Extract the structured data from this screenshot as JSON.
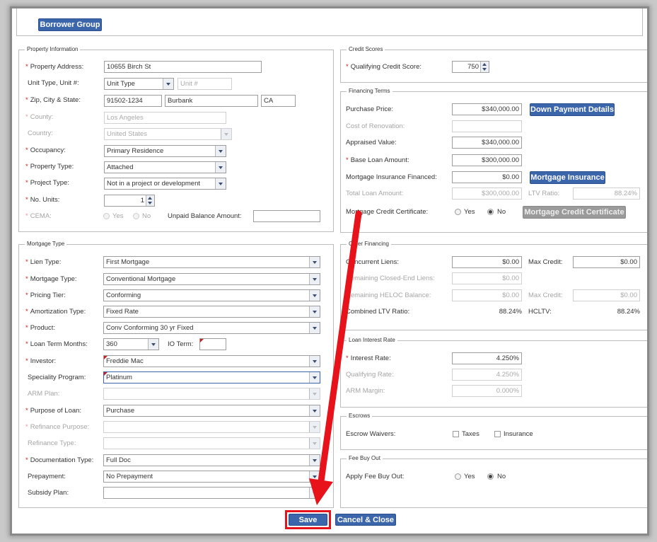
{
  "header": {
    "borrower_group_label": "Borrower Group"
  },
  "property": {
    "legend": "Property Information",
    "address_label": "Property Address:",
    "address_value": "10655 Birch St",
    "unit_label": "Unit Type, Unit #:",
    "unit_type_value": "Unit Type",
    "unit_number_placeholder": "Unit #",
    "zip_label": "Zip, City & State:",
    "zip_value": "91502-1234",
    "city_value": "Burbank",
    "state_value": "CA",
    "county_label": "County:",
    "county_value": "Los Angeles",
    "country_label": "Country:",
    "country_value": "United States",
    "occupancy_label": "Occupancy:",
    "occupancy_value": "Primary Residence",
    "property_type_label": "Property Type:",
    "property_type_value": "Attached",
    "project_type_label": "Project Type:",
    "project_type_value": "Not in a project or development",
    "units_label": "No. Units:",
    "units_value": "1",
    "cema_label": "CEMA:",
    "cema_yes": "Yes",
    "cema_no": "No",
    "unpaid_label": "Unpaid Balance Amount:"
  },
  "mortgage": {
    "legend": "Mortgage Type",
    "lien_label": "Lien Type:",
    "lien_value": "First Mortgage",
    "mtype_label": "Mortgage Type:",
    "mtype_value": "Conventional Mortgage",
    "tier_label": "Pricing Tier:",
    "tier_value": "Conforming",
    "amort_label": "Amortization Type:",
    "amort_value": "Fixed Rate",
    "product_label": "Product:",
    "product_value": "Conv Conforming 30 yr Fixed",
    "term_label": "Loan Term Months:",
    "term_value": "360",
    "io_label": "IO Term:",
    "investor_label": "Investor:",
    "investor_value": "Freddie Mac",
    "specialty_label": "Speciality Program:",
    "specialty_value": "Platinum",
    "arm_label": "ARM Plan:",
    "purpose_label": "Purpose of Loan:",
    "purpose_value": "Purchase",
    "refi_purpose_label": "Refinance Purpose:",
    "refi_type_label": "Refinance Type:",
    "doc_label": "Documentation Type:",
    "doc_value": "Full Doc",
    "prepay_label": "Prepayment:",
    "prepay_value": "No Prepayment",
    "subsidy_label": "Subsidy Plan:"
  },
  "credit": {
    "legend": "Credit Scores",
    "score_label": "Qualifying Credit Score:",
    "score_value": "750"
  },
  "financing": {
    "legend": "Financing Terms",
    "purchase_label": "Purchase Price:",
    "purchase_value": "$340,000.00",
    "down_payment_btn": "Down Payment Details",
    "renovation_label": "Cost of Renovation:",
    "appraised_label": "Appraised Value:",
    "appraised_value": "$340,000.00",
    "base_loan_label": "Base Loan Amount:",
    "base_loan_value": "$300,000.00",
    "mi_financed_label": "Mortgage Insurance Financed:",
    "mi_financed_value": "$0.00",
    "mi_btn": "Mortgage Insurance",
    "total_loan_label": "Total Loan Amount:",
    "total_loan_value": "$300,000.00",
    "ltv_label": "LTV Ratio:",
    "ltv_value": "88.24%",
    "mcc_label": "Mortgage Credit Certificate:",
    "mcc_yes": "Yes",
    "mcc_no": "No",
    "mcc_btn": "Mortgage Credit Certificate"
  },
  "other": {
    "legend": "Other Financing",
    "concurrent_label": "Concurrent Liens:",
    "concurrent_value": "$0.00",
    "max_credit_label": "Max Credit:",
    "max_credit_value": "$0.00",
    "closed_end_label": "Remaining Closed-End Liens:",
    "closed_end_value": "$0.00",
    "heloc_label": "Remaining HELOC Balance:",
    "heloc_value": "$0.00",
    "max_credit2_label": "Max Credit:",
    "max_credit2_value": "$0.00",
    "cltv_label": "Combined LTV Ratio:",
    "cltv_value": "88.24%",
    "hcltv_label": "HCLTV:",
    "hcltv_value": "88.24%"
  },
  "interest": {
    "legend": "Loan Interest Rate",
    "rate_label": "Interest Rate:",
    "rate_value": "4.250%",
    "qual_label": "Qualifying Rate:",
    "qual_value": "4.250%",
    "margin_label": "ARM Margin:",
    "margin_value": "0.000%"
  },
  "escrows": {
    "legend": "Escrows",
    "waivers_label": "Escrow Waivers:",
    "taxes_label": "Taxes",
    "insurance_label": "Insurance"
  },
  "fee": {
    "legend": "Fee Buy Out",
    "apply_label": "Apply Fee Buy Out:",
    "yes": "Yes",
    "no": "No"
  },
  "footer": {
    "save_label": "Save",
    "cancel_label": "Cancel & Close"
  },
  "colors": {
    "accent": "#3c66ac",
    "required": "#c81e1e",
    "annotation": "#e8121a"
  }
}
